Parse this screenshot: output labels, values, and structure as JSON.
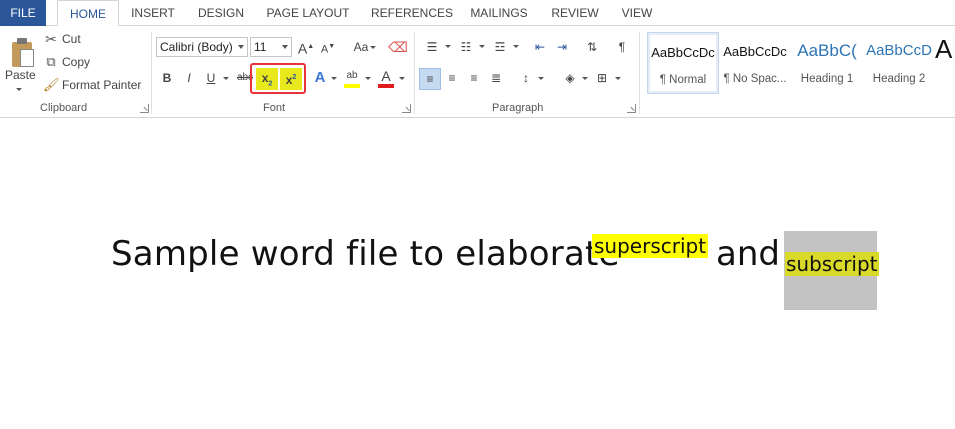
{
  "tabs": {
    "file": "FILE",
    "home": "HOME",
    "insert": "INSERT",
    "design": "DESIGN",
    "page_layout": "PAGE LAYOUT",
    "references": "REFERENCES",
    "mailings": "MAILINGS",
    "review": "REVIEW",
    "view": "VIEW"
  },
  "clipboard": {
    "paste": "Paste",
    "cut": "Cut",
    "copy": "Copy",
    "format_painter": "Format Painter",
    "label": "Clipboard"
  },
  "font": {
    "family": "Calibri (Body)",
    "size": "11",
    "label": "Font",
    "bold": "B",
    "italic": "I",
    "underline": "U",
    "strikethrough": "abc",
    "change_case": "Aa",
    "grow": "A",
    "shrink": "A",
    "text_effects": "A",
    "font_color": "A",
    "highlight_color": "#ffff00",
    "font_color_value": "#e01c1c"
  },
  "paragraph": {
    "label": "Paragraph"
  },
  "styles": [
    {
      "sample": "AaBbCcDc",
      "name": "¶ Normal",
      "sample_color": "#111111"
    },
    {
      "sample": "AaBbCcDc",
      "name": "¶ No Spac...",
      "sample_color": "#111111"
    },
    {
      "sample": "AaBbC(",
      "name": "Heading 1",
      "sample_color": "#2e74b5"
    },
    {
      "sample": "AaBbCcD",
      "name": "Heading 2",
      "sample_color": "#2e74b5"
    },
    {
      "sample": "A",
      "name": "",
      "sample_color": "#111111"
    }
  ],
  "document": {
    "main_text": "Sample word file to elaborate",
    "superscript_text": "superscript",
    "and_text": "and",
    "subscript_text": "subscript"
  },
  "colors": {
    "file_tab": "#2b579a",
    "active_tab_text": "#2b579a",
    "highlight": "#ffff00",
    "selection_gray": "#c3c3c3",
    "annotation_box": "#e8333a"
  }
}
